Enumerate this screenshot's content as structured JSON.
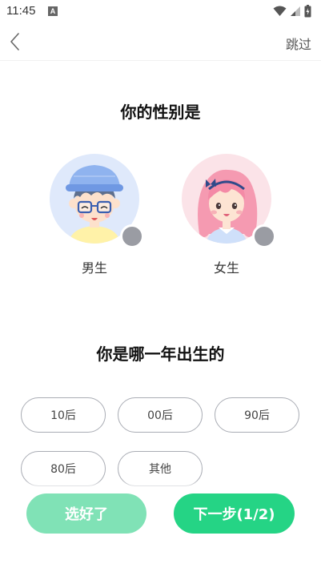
{
  "status_bar": {
    "time": "11:45",
    "notification_icon": "A",
    "icons": [
      "wifi-icon",
      "signal-icon",
      "battery-icon"
    ]
  },
  "nav": {
    "back_icon": "chevron-left-icon",
    "skip_label": "跳过"
  },
  "gender_section": {
    "title": "你的性别是",
    "options": [
      {
        "label": "男生",
        "avatar": "boy-avatar-icon",
        "selected": false
      },
      {
        "label": "女生",
        "avatar": "girl-avatar-icon",
        "selected": false
      }
    ]
  },
  "year_section": {
    "title": "你是哪一年出生的",
    "options": [
      "10后",
      "00后",
      "90后",
      "80后",
      "其他"
    ]
  },
  "actions": {
    "done_label": "选好了",
    "next_label": "下一步(1/2)"
  },
  "colors": {
    "primary": "#25d485",
    "primary_disabled": "#80e2b6",
    "unselected_dot": "#9a9ca3",
    "pill_border": "#a9acb4",
    "male_bg": "#dfe9fb",
    "female_bg": "#fbe3e8"
  }
}
